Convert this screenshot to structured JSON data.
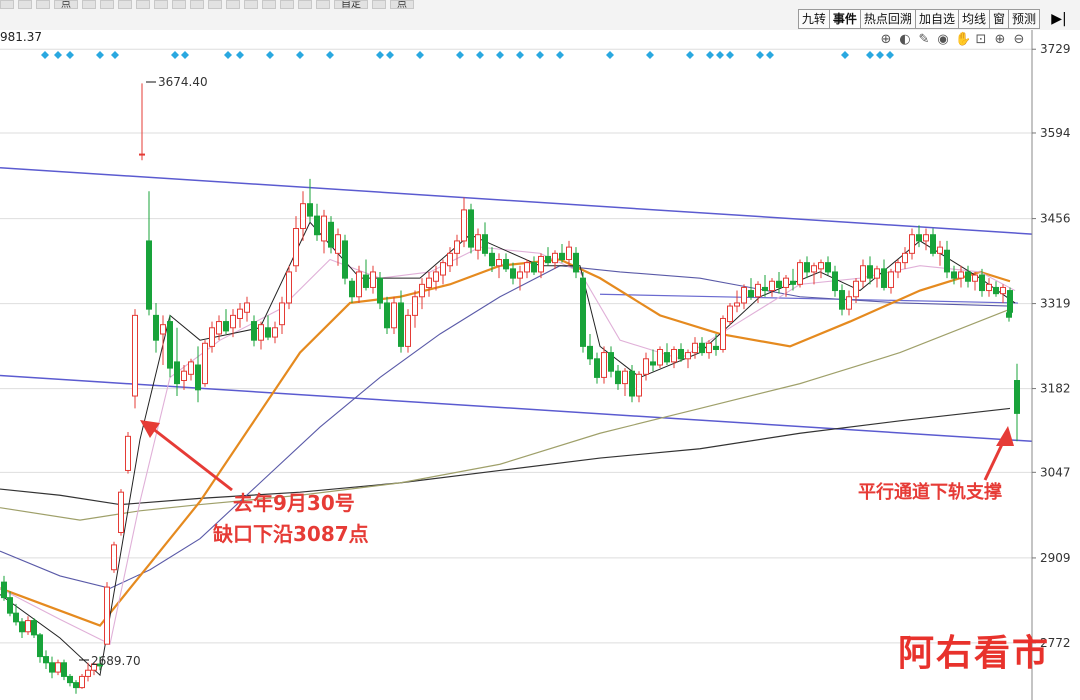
{
  "toolbar": {
    "top_tabs": [
      "",
      "",
      "",
      "点",
      "",
      "",
      "",
      "",
      "",
      "",
      "",
      "",
      "",
      "",
      "",
      "",
      "",
      "",
      "自定",
      "",
      "点"
    ],
    "sub_tabs": [
      "九转",
      "事件",
      "热点回溯",
      "加自选",
      "均线",
      "窗",
      "预测"
    ],
    "active_tab": "事件",
    "collapse_icon": "play-to-end-icon",
    "icons": [
      "zoom-in-icon",
      "toggle-icon",
      "pen-icon",
      "eye-icon",
      "hand-icon",
      "lock-icon",
      "plus-icon",
      "minus-icon"
    ]
  },
  "price_readout": "981.37",
  "chart_data": {
    "type": "candlestick",
    "title": "",
    "xlabel": "",
    "ylabel": "",
    "ylim": [
      2680,
      3760
    ],
    "y_ticks": [
      3729,
      3594,
      3456,
      3319,
      3182,
      3047,
      2909,
      2772
    ],
    "high_label": "3674.40",
    "low_label": "2689.70",
    "annotations": [
      {
        "lines": [
          "去年9月30号",
          "缺口下沿3087点"
        ],
        "color": "#e63b36"
      },
      {
        "lines": [
          "平行通道下轨支撑"
        ],
        "color": "#e63b36"
      }
    ],
    "channel_upper": {
      "color": "#5b5bd0",
      "start": 3538,
      "end": 3431
    },
    "channel_lower": {
      "color": "#5b5bd0",
      "start": 3203,
      "end": 3097
    },
    "closing_segment": [
      {
        "index": 100,
        "open": 3304,
        "high": 3312,
        "low": 3290,
        "close": 3297,
        "color": "green"
      },
      {
        "index": 101,
        "open": 3195,
        "high": 3222,
        "low": 3097,
        "close": 3142,
        "color": "green"
      }
    ],
    "ma_colors": {
      "ma5": "#222222",
      "ma10": "#e0b0d8",
      "ma20": "#e58a1f",
      "ma60": "#9fa06a",
      "ma120": "#5a5aa8",
      "ma250": "#333333"
    },
    "watermark": "阿右看市"
  }
}
